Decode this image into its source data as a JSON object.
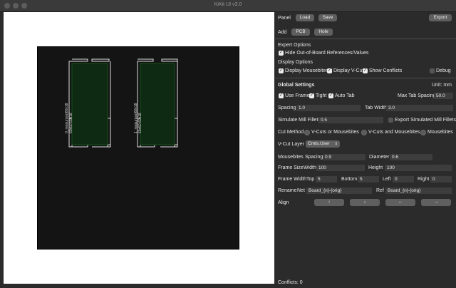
{
  "window": {
    "title": "KiKit UI v3.0"
  },
  "board": {
    "tabs": [
      {
        "label": "0_resources|60x18 60x18 60x50"
      },
      {
        "label": "1_resources|60x18 60x18 60x50"
      }
    ],
    "board_texts": {
      "a1": "0_resources|60x18",
      "a2": "60x50 60x18",
      "b1": "1_resources|60x18",
      "b2": "60x50 60x18"
    }
  },
  "panel": {
    "label": "Panel",
    "load": "Load",
    "save": "Save",
    "export": "Export"
  },
  "add": {
    "label": "Add",
    "pcb": "PCB",
    "hole": "Hole"
  },
  "expert": {
    "heading": "Expert Options",
    "hide_refs": "Hide Out-of-Board References/Values"
  },
  "display": {
    "heading": "Display Options",
    "mousebites": "Display Mousebites",
    "vcut": "Display V-Cut",
    "conflicts": "Show Conflicts",
    "debug": "Debug"
  },
  "global": {
    "heading": "Global Settings",
    "unit": "Unit: mm",
    "use_frame": "Use Frame",
    "tight": "Tight",
    "auto_tab": "Auto Tab",
    "max_tab_spacing_label": "Max Tab Spacing",
    "max_tab_spacing_value": "50.0",
    "spacing_label": "Spacing",
    "spacing_value": "1.0",
    "tab_width_label": "Tab Width",
    "tab_width_value": "3.0",
    "mill_label": "Simulate Mill Fillets",
    "mill_value": "0.5",
    "export_mill": "Export Simulated Mill Fillets",
    "cut_method_label": "Cut Method",
    "cut_opt1": "V-Cuts or Mousebites",
    "cut_opt2": "V-Cuts and Mousebites",
    "cut_opt3": "Mousebites",
    "vcut_layer_label": "V-Cut Layer",
    "vcut_layer_value": "Cmts.User",
    "mousebites_label": "Mousebites",
    "mb_spacing_label": "Spacing",
    "mb_spacing_value": "0.9",
    "mb_diameter_label": "Diameter",
    "mb_diameter_value": "0.6",
    "frame_size_label": "Frame Size",
    "fs_width_label": "Width",
    "fs_width_value": "100",
    "fs_height_label": "Height",
    "fs_height_value": "100",
    "frame_width_label": "Frame Width",
    "fw_top_label": "Top",
    "fw_top_value": "5",
    "fw_bottom_label": "Bottom",
    "fw_bottom_value": "5",
    "fw_left_label": "Left",
    "fw_left_value": "0",
    "fw_right_label": "Right",
    "fw_right_value": "0",
    "rename_label": "Rename",
    "net_label": "Net",
    "net_value": "Board_{n}-{orig}",
    "ref_label": "Ref",
    "ref_value": "Board_{n}-{orig}",
    "align_label": "Align",
    "align_up": "↑",
    "align_down": "↓",
    "align_left": "←",
    "align_right": "→"
  },
  "status": {
    "conflicts": "Conflicts: 0"
  }
}
